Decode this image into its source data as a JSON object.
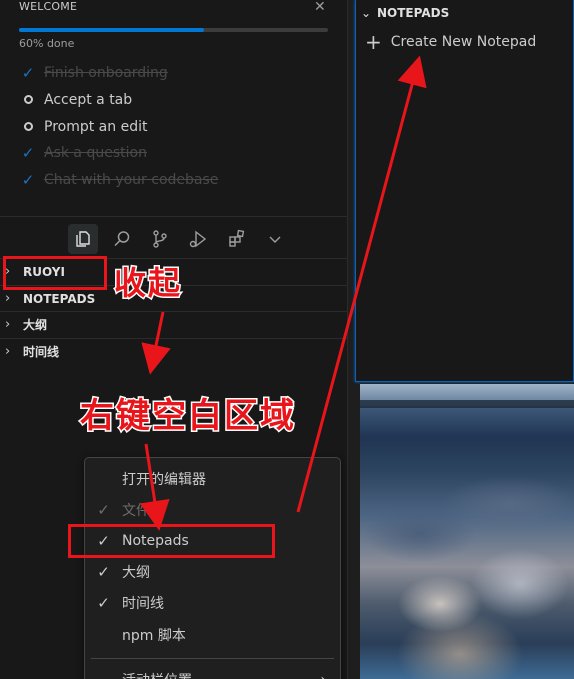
{
  "welcome": {
    "title": "WELCOME",
    "close_icon": "close-icon",
    "progress_text": "60% done",
    "progress_fraction": 0.6,
    "tasks": [
      {
        "label": "Finish onboarding",
        "done": true
      },
      {
        "label": "Accept a tab",
        "done": false
      },
      {
        "label": "Prompt an edit",
        "done": false
      },
      {
        "label": "Ask a question",
        "done": true
      },
      {
        "label": "Chat with your codebase",
        "done": true
      }
    ]
  },
  "activity_bar": {
    "icons": [
      "explorer-icon",
      "search-icon",
      "source-control-icon",
      "run-debug-icon",
      "extensions-icon",
      "chevron-down-icon"
    ]
  },
  "sections": [
    {
      "label": "RUOYI"
    },
    {
      "label": "NOTEPADS"
    },
    {
      "label": "大纲"
    },
    {
      "label": "时间线"
    }
  ],
  "context_menu": {
    "items": [
      {
        "label": "打开的编辑器",
        "checked": false,
        "dim": false
      },
      {
        "label": "文件夹",
        "checked": true,
        "dim": true
      },
      {
        "label": "Notepads",
        "checked": true,
        "dim": false
      },
      {
        "label": "大纲",
        "checked": true,
        "dim": false
      },
      {
        "label": "时间线",
        "checked": true,
        "dim": false
      },
      {
        "label": "npm 脚本",
        "checked": false,
        "dim": false
      },
      {
        "label": "活动栏位置",
        "checked": false,
        "dim": false,
        "submenu": true
      }
    ]
  },
  "notepads_pane": {
    "header": "NOTEPADS",
    "create_label": "Create New Notepad"
  },
  "annotations": {
    "collapse_text": "收起",
    "right_click_text": "右键空白区域",
    "color": "#e8151b"
  }
}
